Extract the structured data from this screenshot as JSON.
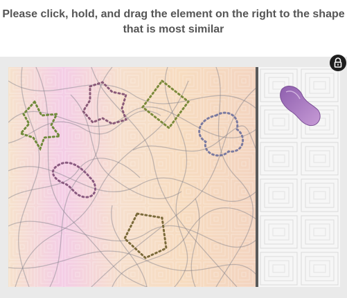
{
  "instruction": "Please click, hold, and drag the element on the right to the shape that is most similar",
  "icons": {
    "lock": "lock-icon"
  },
  "colors": {
    "panel": "#eaeaea",
    "divider": "#5a5a5a",
    "piece": "#9a6fb0"
  }
}
